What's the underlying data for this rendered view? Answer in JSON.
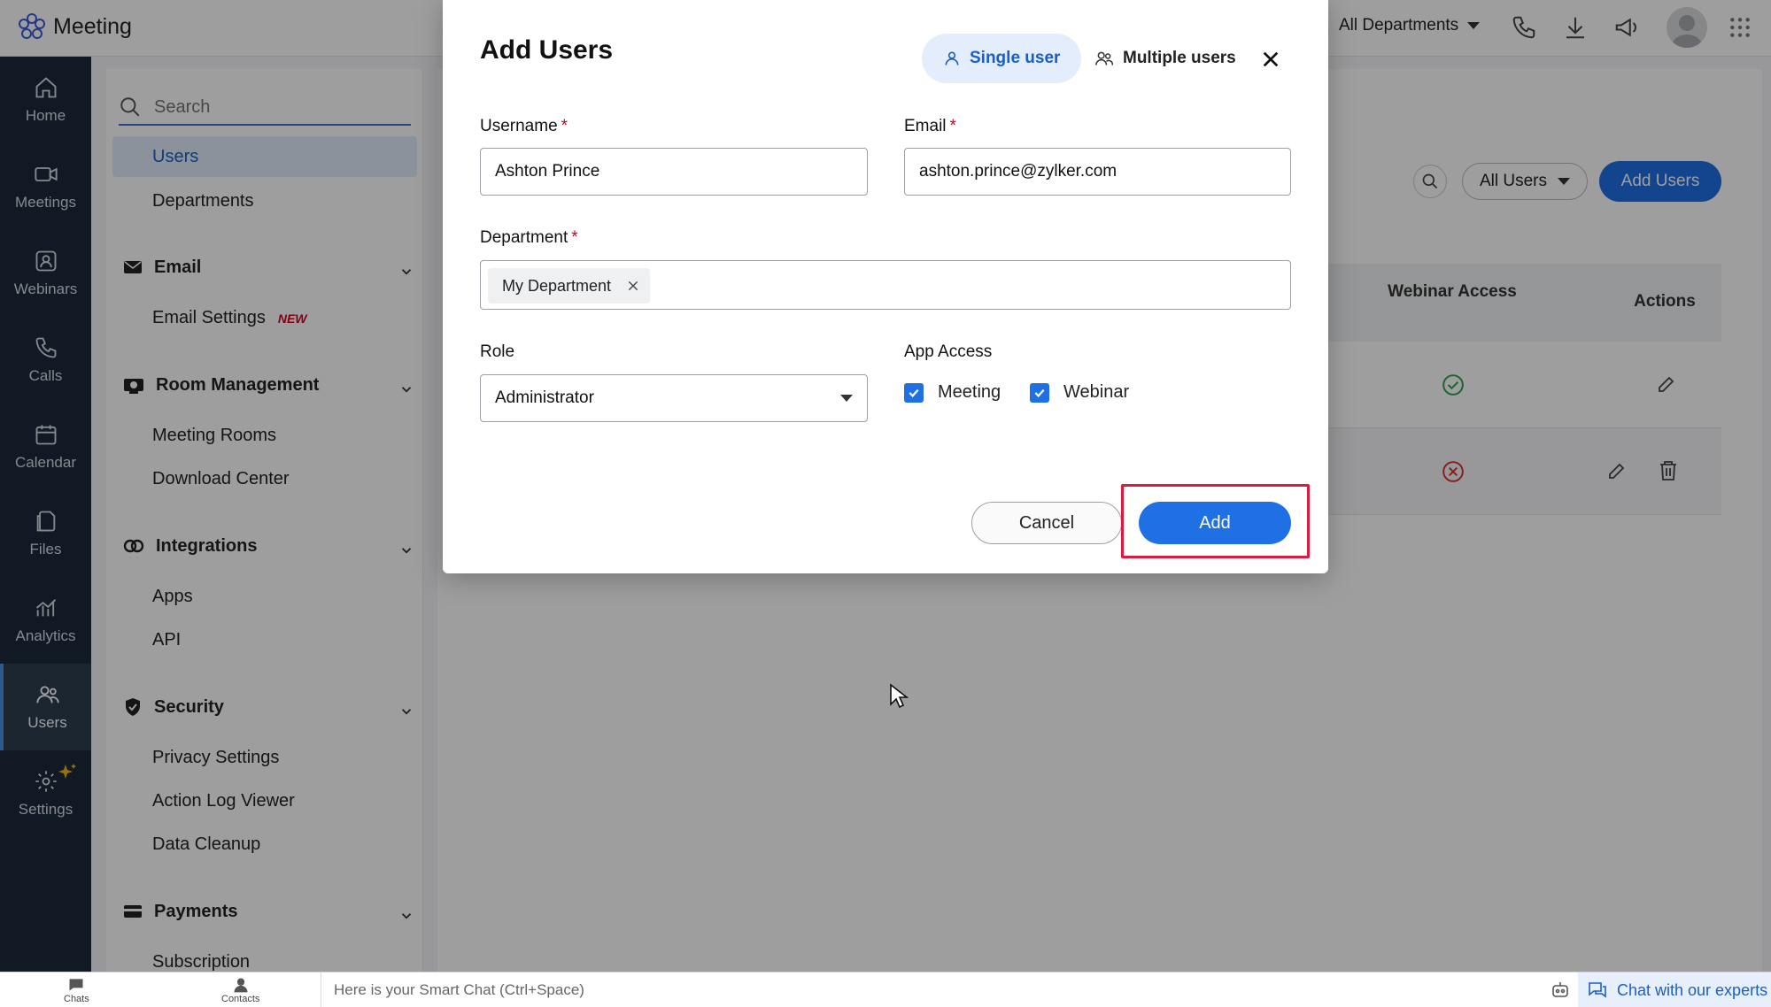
{
  "app": {
    "name": "Meeting",
    "department_filter": "All Departments"
  },
  "leftnav": [
    {
      "label": "Home",
      "icon": "home-icon"
    },
    {
      "label": "Meetings",
      "icon": "video-icon"
    },
    {
      "label": "Webinars",
      "icon": "webinar-icon"
    },
    {
      "label": "Calls",
      "icon": "phone-icon"
    },
    {
      "label": "Calendar",
      "icon": "calendar-icon"
    },
    {
      "label": "Files",
      "icon": "files-icon"
    },
    {
      "label": "Analytics",
      "icon": "analytics-icon"
    },
    {
      "label": "Users",
      "icon": "users-icon",
      "active": true
    },
    {
      "label": "Settings",
      "icon": "gear-icon"
    }
  ],
  "sidebar": {
    "search_placeholder": "Search",
    "users": "Users",
    "departments": "Departments",
    "email": {
      "title": "Email",
      "settings": "Email Settings",
      "badge": "NEW"
    },
    "room": {
      "title": "Room Management",
      "meeting_rooms": "Meeting Rooms",
      "download_center": "Download Center"
    },
    "integrations": {
      "title": "Integrations",
      "apps": "Apps",
      "api": "API"
    },
    "security": {
      "title": "Security",
      "privacy": "Privacy Settings",
      "action_log": "Action Log Viewer",
      "cleanup": "Data Cleanup"
    },
    "payments": {
      "title": "Payments",
      "subscription": "Subscription"
    }
  },
  "main": {
    "filter": "All Users",
    "add_users": "Add Users",
    "columns": {
      "webinar_access": "Webinar Access",
      "actions": "Actions"
    },
    "rows": [
      {
        "webinar_access": "yes"
      },
      {
        "webinar_access": "no"
      }
    ]
  },
  "modal": {
    "title": "Add Users",
    "tab_single": "Single user",
    "tab_multiple": "Multiple users",
    "username_label": "Username",
    "username_value": "Ashton Prince",
    "email_label": "Email",
    "email_value": "ashton.prince@zylker.com",
    "department_label": "Department",
    "department_chip": "My Department",
    "role_label": "Role",
    "role_value": "Administrator",
    "app_access_label": "App Access",
    "meeting": "Meeting",
    "webinar": "Webinar",
    "cancel": "Cancel",
    "add": "Add",
    "required_mark": "*"
  },
  "bottombar": {
    "chats": "Chats",
    "contacts": "Contacts",
    "smart_chat": "Here is your Smart Chat (Ctrl+Space)",
    "chat_experts": "Chat with our experts"
  },
  "colors": {
    "accent": "#1f6fe5",
    "nav_bg": "#1c2b3a",
    "highlight": "#e0193f",
    "required": "#d0021b"
  }
}
